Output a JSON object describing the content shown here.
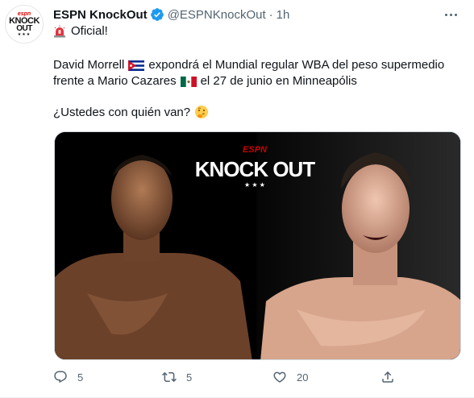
{
  "tweet": {
    "author_name": "ESPN KnockOut",
    "handle": "@ESPNKnockOut",
    "separator": "·",
    "time": "1h",
    "avatar": {
      "espn": "espn",
      "line1": "KNOCK",
      "line2": "OUT",
      "stars": "★★★"
    },
    "line1": "Oficial!",
    "body_part1": "David Morrell",
    "body_part2": "expondrá el Mundial regular WBA del peso supermedio",
    "body_part3": "frente a Mario Cazares",
    "body_part4": "el 27 de junio en Minneapólis",
    "question": "¿Ustedes con quién van?",
    "media": {
      "logo_espn": "ESPN",
      "logo_line1": "KNOCK OUT",
      "logo_stars": "★ ★ ★"
    },
    "actions": {
      "reply_count": "5",
      "retweet_count": "5",
      "like_count": "20"
    },
    "icons": {
      "verified": "verified-badge-icon",
      "siren": "siren-icon",
      "flag_cuba": "cuba-flag-icon",
      "flag_mexico": "mexico-flag-icon",
      "thinking": "thinking-face-icon",
      "reply": "reply-icon",
      "retweet": "retweet-icon",
      "like": "heart-icon",
      "share": "share-icon",
      "more": "more-icon"
    },
    "colors": {
      "accent": "#1d9bf0",
      "secondary_text": "#536471",
      "primary_text": "#0f1419",
      "brand_red": "#d00000"
    }
  }
}
